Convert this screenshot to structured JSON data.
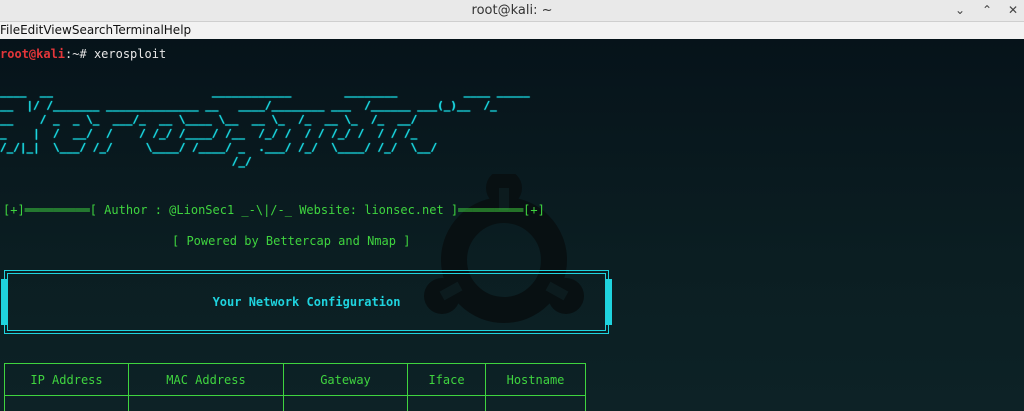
{
  "window": {
    "title": "root@kali: ~",
    "controls": [
      "⌄",
      "⌃",
      "✕"
    ]
  },
  "menu": [
    "File",
    "Edit",
    "View",
    "Search",
    "Terminal",
    "Help"
  ],
  "prompt": {
    "user": "root@kali",
    "rest": ":~# ",
    "command": "xerosploit"
  },
  "banner": {
    "art": "____  __                        ____________        ________          ____ _____\n__  |/ /_______ ______________ __   ____/________ ___  /______ ___(_)__  /_\n__    / _  _ \\_  ___/_  __ \\____ \\__  __ \\_  /_  __ \\_  /_  __/\n_    |  /  __/  /    / /_/ /____/ /__  /_/ /  / / /_/ /  / / /_\n/_/|_|  \\___/ /_/     \\____/ /____/ _  .___/ /_/  \\____/ /_/  \\__/\n                                   /_/"
  },
  "author_line": "[+]═════════[ Author : @LionSec1 _-\\|/-_ Website: lionsec.net ]═════════[+]",
  "powered_line": "[ Powered by Bettercap and Nmap ]",
  "network_config_title": "Your Network Configuration",
  "network_table": {
    "headers": [
      "IP Address",
      "MAC Address",
      "Gateway",
      "Iface",
      "Hostname"
    ]
  },
  "colors": {
    "banner": "#1fd3de",
    "text_green": "#3fd43f",
    "prompt_user": "#e3363a",
    "background": "#0a1418"
  },
  "icons": {
    "watermark": "ubuntu-logo-watermark"
  }
}
